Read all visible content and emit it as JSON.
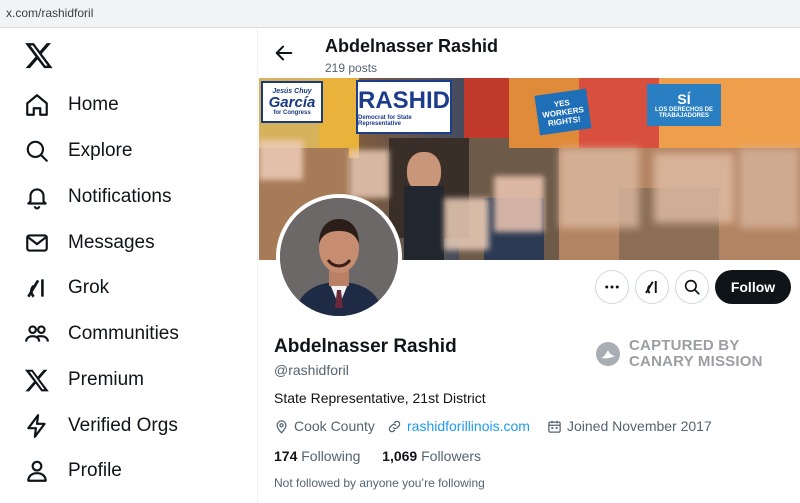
{
  "browser": {
    "url": "x.com/rashidforil"
  },
  "sidebar": {
    "items": [
      {
        "label": "Home",
        "icon": "home-icon"
      },
      {
        "label": "Explore",
        "icon": "search-icon"
      },
      {
        "label": "Notifications",
        "icon": "bell-icon"
      },
      {
        "label": "Messages",
        "icon": "envelope-icon"
      },
      {
        "label": "Grok",
        "icon": "grok-icon"
      },
      {
        "label": "Communities",
        "icon": "people-icon"
      },
      {
        "label": "Premium",
        "icon": "x-logo-icon"
      },
      {
        "label": "Verified Orgs",
        "icon": "lightning-icon"
      },
      {
        "label": "Profile",
        "icon": "person-icon"
      }
    ]
  },
  "header": {
    "name": "Abdelnasser Rashid",
    "posts": "219 posts"
  },
  "banner": {
    "sign_garcia_top": "Jesús Chuy",
    "sign_garcia_main": "García",
    "sign_garcia_sub": "for Congress",
    "sign_rashid_main": "RASHID",
    "sign_rashid_sub": "Democrat for State Representative",
    "sign_workers": "YES WORKERS RIGHTS!",
    "sign_derechos_main": "SÍ",
    "sign_derechos_sub": "LOS DERECHOS DE TRABAJADORES"
  },
  "actions": {
    "follow_label": "Follow"
  },
  "profile": {
    "name": "Abdelnasser Rashid",
    "handle": "@rashidforil",
    "bio": "State Representative, 21st District",
    "location": "Cook County",
    "website": "rashidforillinois.com",
    "joined": "Joined November 2017",
    "following_count": "174",
    "following_label": "Following",
    "followers_count": "1,069",
    "followers_label": "Followers",
    "not_followed": "Not followed by anyone you’re following"
  },
  "watermark": {
    "line1": "CAPTURED BY",
    "line2": "CANARY MISSION"
  },
  "colors": {
    "accent": "#1d9bf0",
    "text": "#0f1419",
    "muted": "#536471",
    "follow_bg": "#0f1419"
  }
}
